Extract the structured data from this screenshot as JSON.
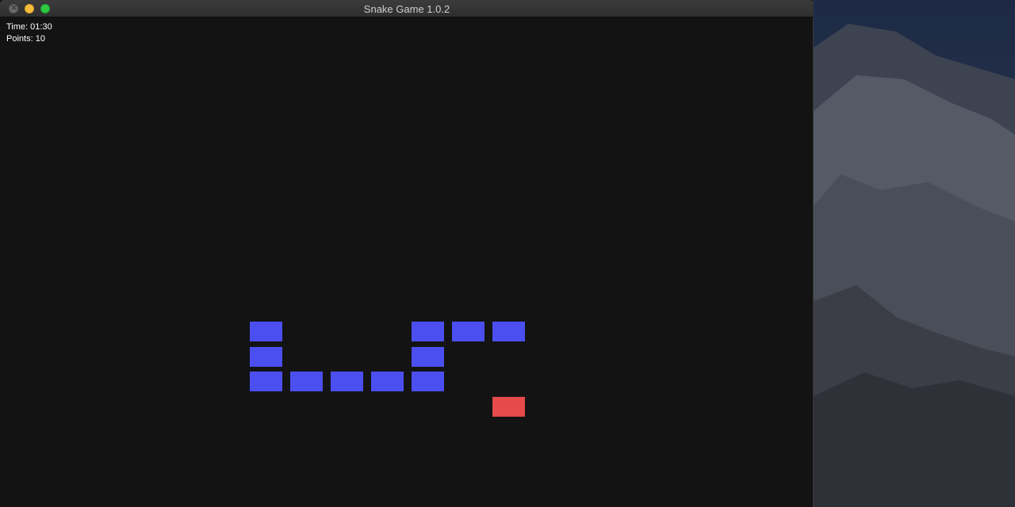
{
  "window": {
    "title": "Snake Game 1.0.2"
  },
  "hud": {
    "time_label": "Time:",
    "time_value": "01:30",
    "points_label": "Points:",
    "points_value": "10"
  },
  "colors": {
    "snake": "#4b4ff0",
    "food": "#e64a4a",
    "board": "#131313"
  },
  "game": {
    "snake_segments": [
      {
        "col": 0,
        "row": 0
      },
      {
        "col": 0,
        "row": 1
      },
      {
        "col": 0,
        "row": 2
      },
      {
        "col": 1,
        "row": 2
      },
      {
        "col": 2,
        "row": 2
      },
      {
        "col": 3,
        "row": 2
      },
      {
        "col": 4,
        "row": 2
      },
      {
        "col": 4,
        "row": 1
      },
      {
        "col": 4,
        "row": 0
      },
      {
        "col": 5,
        "row": 0
      },
      {
        "col": 6,
        "row": 0
      }
    ],
    "food": {
      "col": 6,
      "row": 3
    }
  }
}
